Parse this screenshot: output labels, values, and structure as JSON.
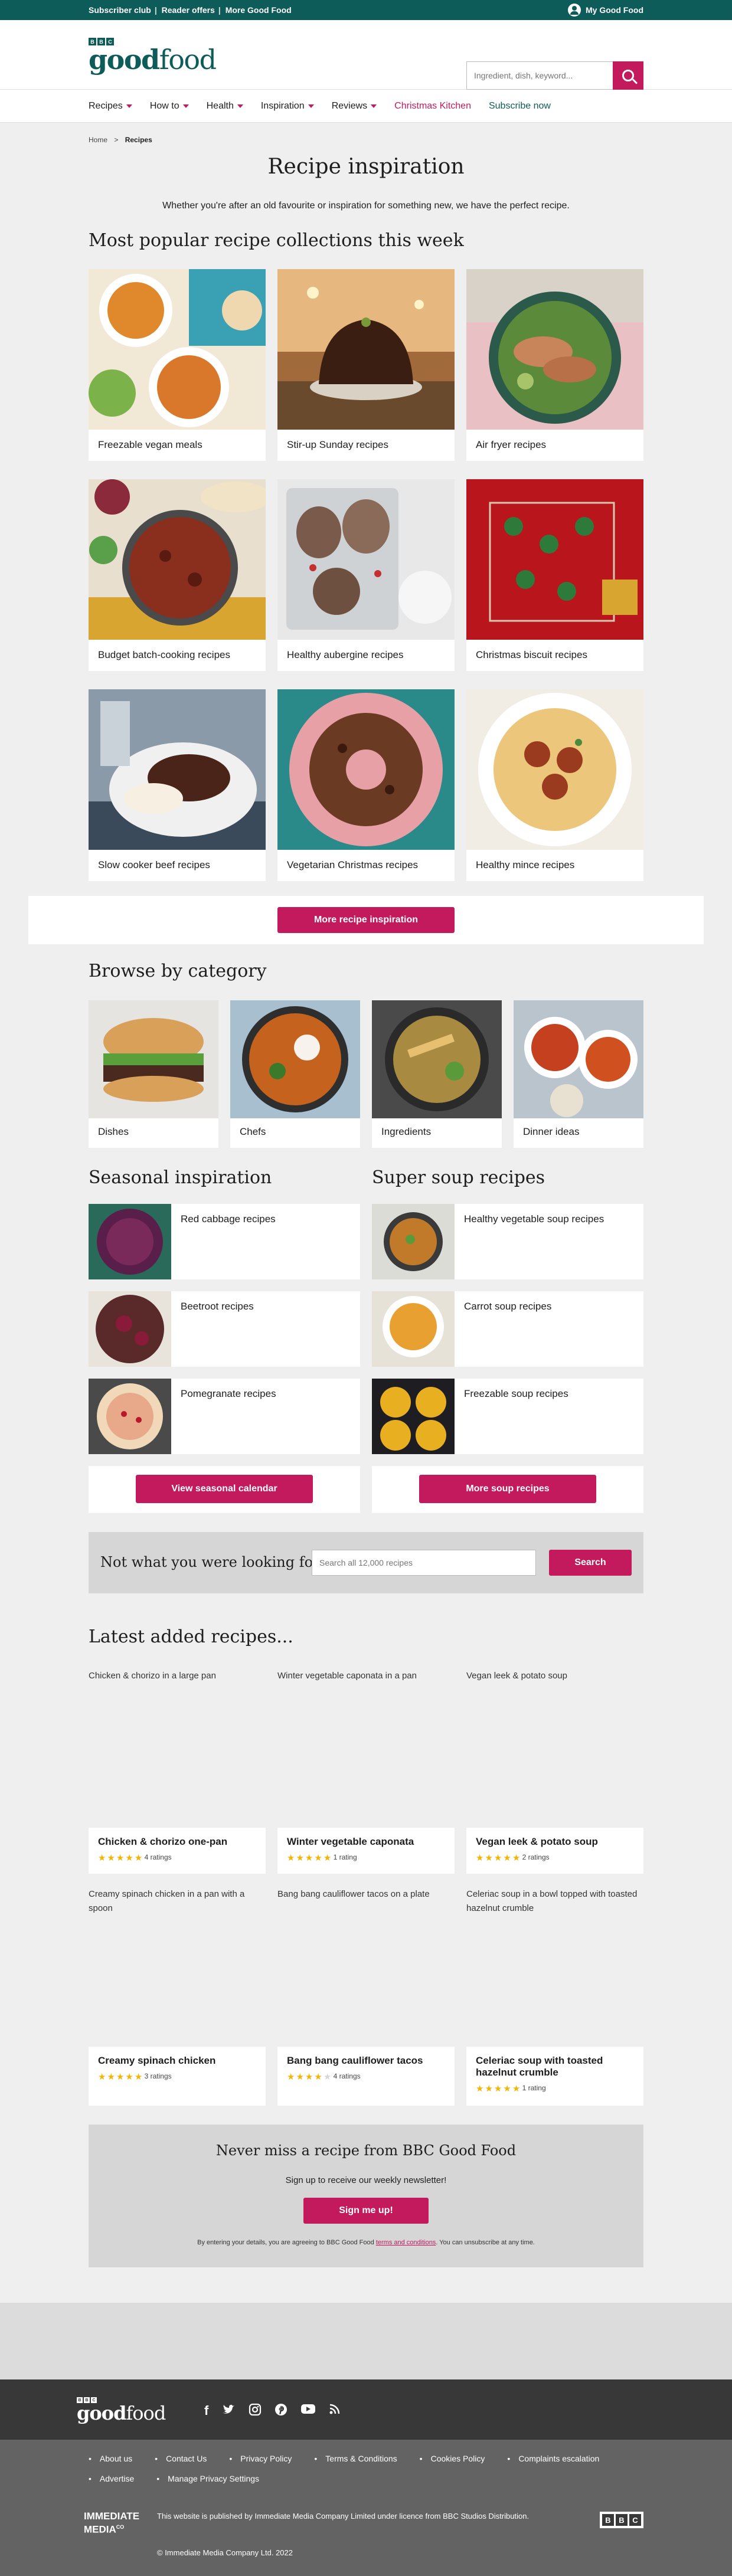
{
  "topbar": {
    "links": [
      "Subscriber club",
      "Reader offers",
      "More Good Food"
    ],
    "account": "My Good Food"
  },
  "header": {
    "logo_bbc": [
      "B",
      "B",
      "C"
    ],
    "logo_good": "good",
    "logo_food": "food",
    "search_placeholder": "Ingredient, dish, keyword..."
  },
  "nav": {
    "items": [
      {
        "label": "Recipes"
      },
      {
        "label": "How to"
      },
      {
        "label": "Health"
      },
      {
        "label": "Inspiration"
      },
      {
        "label": "Reviews"
      },
      {
        "label": "Christmas Kitchen"
      },
      {
        "label": "Subscribe now"
      }
    ]
  },
  "breadcrumb": {
    "home": "Home",
    "chev": ">",
    "current": "Recipes"
  },
  "page": {
    "title": "Recipe inspiration",
    "intro": "Whether you're after an old favourite or inspiration for something new, we have the perfect recipe."
  },
  "popular": {
    "heading": "Most popular recipe collections this week",
    "cards": [
      "Freezable vegan meals",
      "Stir-up Sunday recipes",
      "Air fryer recipes",
      "Budget batch-cooking recipes",
      "Healthy aubergine recipes",
      "Christmas biscuit recipes",
      "Slow cooker beef recipes",
      "Vegetarian Christmas recipes",
      "Healthy mince recipes"
    ],
    "button": "More recipe inspiration"
  },
  "browse": {
    "heading": "Browse by category",
    "cards": [
      "Dishes",
      "Chefs",
      "Ingredients",
      "Dinner ideas"
    ]
  },
  "seasonal": {
    "heading": "Seasonal inspiration",
    "items": [
      "Red cabbage recipes",
      "Beetroot recipes",
      "Pomegranate recipes"
    ],
    "button": "View seasonal calendar"
  },
  "soup": {
    "heading": "Super soup recipes",
    "items": [
      "Healthy vegetable soup recipes",
      "Carrot soup recipes",
      "Freezable soup recipes"
    ],
    "button": "More soup recipes"
  },
  "lookup": {
    "heading": "Not what you were looking for?",
    "placeholder": "Search all 12,000 recipes",
    "button": "Search"
  },
  "latest": {
    "heading": "Latest added recipes...",
    "recipes": [
      {
        "caption": "Chicken & chorizo in a large pan",
        "title": "Chicken & chorizo one-pan",
        "ratings": "4 ratings",
        "stars": 5
      },
      {
        "caption": "Winter vegetable caponata in a pan",
        "title": "Winter vegetable caponata",
        "ratings": "1 rating",
        "stars": 5
      },
      {
        "caption": "Vegan leek & potato soup",
        "title": "Vegan leek & potato soup",
        "ratings": "2 ratings",
        "stars": 5
      },
      {
        "caption": "Creamy spinach chicken in a pan with a spoon",
        "title": "Creamy spinach chicken",
        "ratings": "3 ratings",
        "stars": 5
      },
      {
        "caption": "Bang bang cauliflower tacos on a plate",
        "title": "Bang bang cauliflower tacos",
        "ratings": "4 ratings",
        "stars": 4
      },
      {
        "caption": "Celeriac soup in a bowl topped with toasted hazelnut crumble",
        "title": "Celeriac soup with toasted hazelnut crumble",
        "ratings": "1 rating",
        "stars": 5
      }
    ]
  },
  "newsletter": {
    "heading": "Never miss a recipe from BBC Good Food",
    "sub": "Sign up to receive our weekly newsletter!",
    "button": "Sign me up!",
    "legal_pre": "By entering your details, you are agreeing to BBC Good Food",
    "legal_link": "terms and conditions",
    "legal_post": ". You can unsubscribe at any time."
  },
  "footer": {
    "social_icons": [
      "facebook-icon",
      "twitter-icon",
      "instagram-icon",
      "pinterest-icon",
      "youtube-icon",
      "rss-icon"
    ],
    "links": [
      "About us",
      "Contact Us",
      "Privacy Policy",
      "Terms & Conditions",
      "Cookies Policy",
      "Complaints escalation",
      "Advertise",
      "Manage Privacy Settings"
    ],
    "publisher_logo_top": "IMMEDIATE",
    "publisher_logo_bottom": "MEDIA",
    "publisher_logo_co": "CO",
    "publisher": "This website is published by Immediate Media Company Limited under licence from BBC Studios Distribution.",
    "copyright": "© Immediate Media Company Ltd. 2022",
    "bbc_logo": [
      "B",
      "B",
      "C"
    ]
  },
  "colors": {
    "brand": "#0e5c5a",
    "accent": "#c3195d",
    "star": "#f5b400"
  }
}
